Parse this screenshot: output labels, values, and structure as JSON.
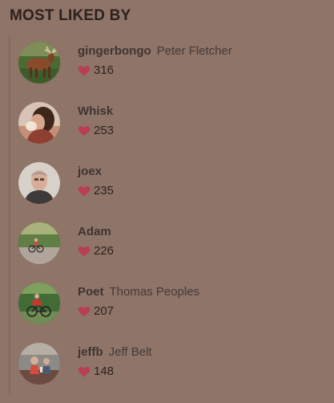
{
  "header": {
    "title": "MOST LIKED BY"
  },
  "likers": [
    {
      "username": "gingerbongo",
      "full_name": "Peter Fletcher",
      "likes": "316",
      "avatar_icon": "avatar-elk-icon"
    },
    {
      "username": "Whisk",
      "full_name": "",
      "likes": "253",
      "avatar_icon": "avatar-person-hair-icon"
    },
    {
      "username": "joex",
      "full_name": "",
      "likes": "235",
      "avatar_icon": "avatar-portrait-icon"
    },
    {
      "username": "Adam",
      "full_name": "",
      "likes": "226",
      "avatar_icon": "avatar-cyclist-road-icon"
    },
    {
      "username": "Poet",
      "full_name": "Thomas Peoples",
      "likes": "207",
      "avatar_icon": "avatar-cyclist-forest-icon"
    },
    {
      "username": "jeffb",
      "full_name": "Jeff Belt",
      "likes": "148",
      "avatar_icon": "avatar-outdoor-person-icon"
    }
  ],
  "colors": {
    "background": "#8f7468",
    "heart": "#b83d55",
    "text": "#2c221e"
  }
}
